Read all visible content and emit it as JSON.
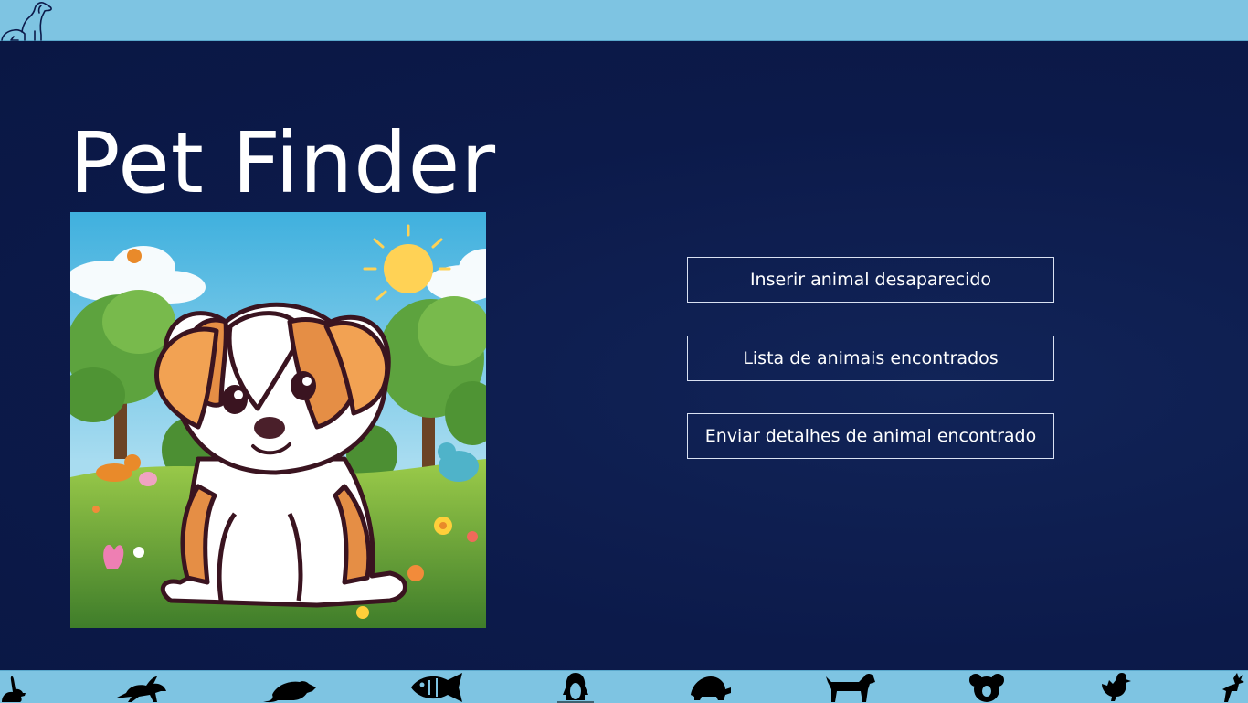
{
  "app": {
    "title": "Pet Finder"
  },
  "header": {
    "logo_icon": "dog-outline-icon"
  },
  "hero": {
    "image_icon": "cartoon-puppy-in-garden-illustration"
  },
  "actions": {
    "insert_missing_label": "Inserir animal desaparecido",
    "found_list_label": "Lista de animais encontrados",
    "send_found_label": "Enviar detalhes de animal encontrado"
  },
  "footer": {
    "icons": [
      "rabbit-icon",
      "hare-icon",
      "rat-icon",
      "fish-icon",
      "penguin-icon",
      "turtle-icon",
      "dog-icon",
      "koala-icon",
      "chicken-icon",
      "deer-icon"
    ]
  },
  "colors": {
    "background": "#0c1a4a",
    "bar": "#7ec4e2",
    "button_border": "#d9e1f2",
    "text": "#ffffff"
  }
}
